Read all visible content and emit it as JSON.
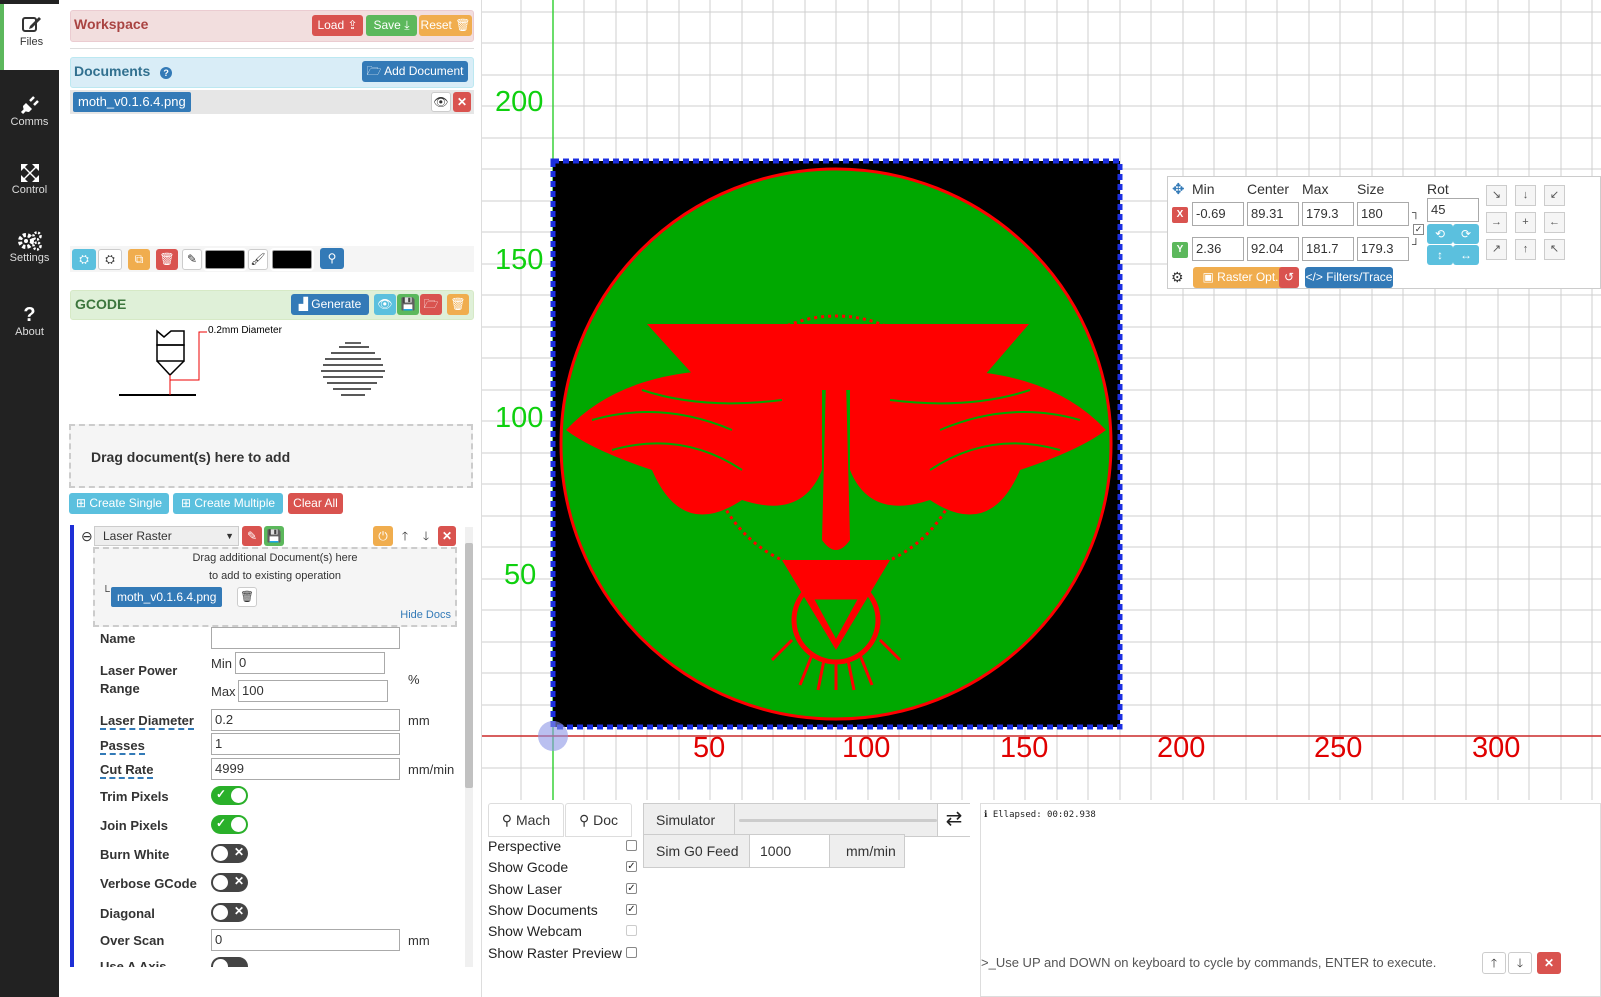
{
  "nav": [
    {
      "label": "Files",
      "icon": "edit-icon"
    },
    {
      "label": "Comms",
      "icon": "plug-icon"
    },
    {
      "label": "Control",
      "icon": "arrows-icon"
    },
    {
      "label": "Settings",
      "icon": "gears-icon"
    },
    {
      "label": "About",
      "icon": "question-icon"
    }
  ],
  "workspace": {
    "title": "Workspace",
    "load": "Load",
    "save": "Save",
    "reset": "Reset"
  },
  "documents": {
    "title": "Documents",
    "add": "Add Document",
    "items": [
      "moth_v0.1.6.4.png"
    ]
  },
  "gcode": {
    "title": "GCODE",
    "generate": "Generate",
    "tool_caption": "0.2mm Diameter",
    "drop_text": "Drag document(s) here to add",
    "create_single": "Create Single",
    "create_multiple": "Create Multiple",
    "clear_all": "Clear All"
  },
  "operation": {
    "type": "Laser Raster",
    "drag_hint_1": "Drag additional Document(s) here",
    "drag_hint_2": "to add to existing operation",
    "doc": "moth_v0.1.6.4.png",
    "hide_docs": "Hide Docs",
    "name_label": "Name",
    "name_value": "",
    "power_label_1": "Laser Power",
    "power_label_2": "Range",
    "min_label": "Min",
    "min_value": "0",
    "max_label": "Max",
    "max_value": "100",
    "percent": "%",
    "diameter_label": "Laser Diameter",
    "diameter_value": "0.2",
    "diameter_unit": "mm",
    "passes_label": "Passes",
    "passes_value": "1",
    "cut_rate_label": "Cut Rate",
    "cut_rate_value": "4999",
    "cut_rate_unit": "mm/min",
    "trim_pixels": "Trim Pixels",
    "join_pixels": "Join Pixels",
    "burn_white": "Burn White",
    "verbose_gcode": "Verbose GCode",
    "diagonal": "Diagonal",
    "over_scan_label": "Over Scan",
    "over_scan_value": "0",
    "over_scan_unit": "mm",
    "use_a_axis": "Use A Axis",
    "toggles": {
      "trim_pixels": true,
      "join_pixels": true,
      "burn_white": false,
      "verbose_gcode": false,
      "diagonal": false
    }
  },
  "axes": {
    "y_labels": [
      "200",
      "150",
      "100",
      "50"
    ],
    "x_labels": [
      "50",
      "100",
      "150",
      "200",
      "250",
      "300"
    ]
  },
  "transform": {
    "headers": {
      "min": "Min",
      "center": "Center",
      "max": "Max",
      "size": "Size",
      "rot": "Rot"
    },
    "x": {
      "label": "X",
      "min": "-0.69",
      "center": "89.31",
      "max": "179.3",
      "size": "180"
    },
    "y": {
      "label": "Y",
      "min": "2.36",
      "center": "92.04",
      "max": "181.7",
      "size": "179.3"
    },
    "rot": "45",
    "raster_opt": "Raster Opt.",
    "filters": "Filters/Trace"
  },
  "bottom": {
    "mach": "Mach",
    "doc": "Doc",
    "simulator": "Simulator",
    "sim_feed_label": "Sim G0 Feed",
    "sim_feed_value": "1000",
    "sim_feed_unit": "mm/min",
    "checks": [
      {
        "label": "Perspective",
        "checked": false
      },
      {
        "label": "Show Gcode",
        "checked": true
      },
      {
        "label": "Show Laser",
        "checked": true
      },
      {
        "label": "Show Documents",
        "checked": true
      },
      {
        "label": "Show Webcam",
        "checked": false
      },
      {
        "label": "Show Raster Preview",
        "checked": false
      }
    ],
    "console_line": "Ellapsed: 00:02.938",
    "console_prompt": "Use UP and DOWN on keyboard to cycle by commands, ENTER to execute."
  }
}
